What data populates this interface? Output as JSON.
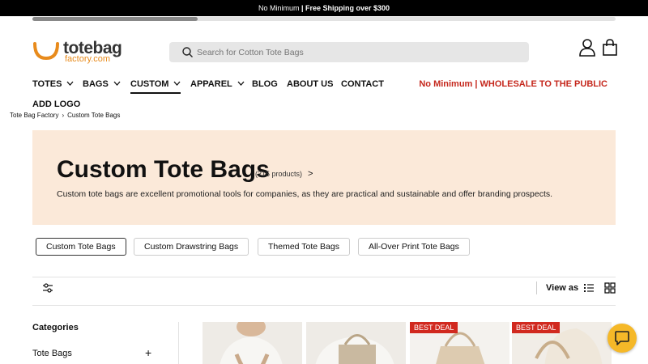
{
  "announcement": {
    "normal": "No Minimum",
    "bold": "| Free Shipping over $300"
  },
  "logo": {
    "brand": "totebag",
    "sub": "factory.com"
  },
  "search": {
    "placeholder": "Search for Cotton Tote Bags"
  },
  "icons": {
    "account": "user-icon",
    "cart": "shopping-bag-icon",
    "search": "search-icon"
  },
  "nav": {
    "items": [
      {
        "label": "TOTES",
        "dropdown": true
      },
      {
        "label": "BAGS",
        "dropdown": true
      },
      {
        "label": "CUSTOM",
        "dropdown": true,
        "active": true
      },
      {
        "label": "APPAREL",
        "dropdown": true
      },
      {
        "label": "BLOG",
        "dropdown": false
      },
      {
        "label": "ABOUT US",
        "dropdown": false
      },
      {
        "label": "CONTACT",
        "dropdown": false
      }
    ],
    "promo": "No Minimum | WHOLESALE TO THE PUBLIC",
    "add_logo": "ADD LOGO"
  },
  "breadcrumb": {
    "home": "Tote Bag Factory",
    "current": "Custom Tote Bags"
  },
  "hero": {
    "title": "Custom Tote Bags",
    "count": "(215 products)",
    "arrow": ">",
    "description": "Custom tote bags are excellent promotional tools for companies, as they are practical and sustainable and offer branding prospects."
  },
  "subcategories": [
    "Custom Tote Bags",
    "Custom Drawstring Bags",
    "Themed Tote Bags",
    "All-Over Print Tote Bags"
  ],
  "toolbar": {
    "view_as": "View as"
  },
  "sidebar": {
    "title": "Categories",
    "first_item": "Tote Bags"
  },
  "products": [
    {
      "badge": ""
    },
    {
      "badge": ""
    },
    {
      "badge": "BEST DEAL"
    },
    {
      "badge": "BEST DEAL"
    }
  ],
  "colors": {
    "accent": "#e88b1c",
    "promo": "#c5271c",
    "hero_bg": "#fbe9d9",
    "badge": "#d1291f",
    "chat": "#f5b828"
  }
}
